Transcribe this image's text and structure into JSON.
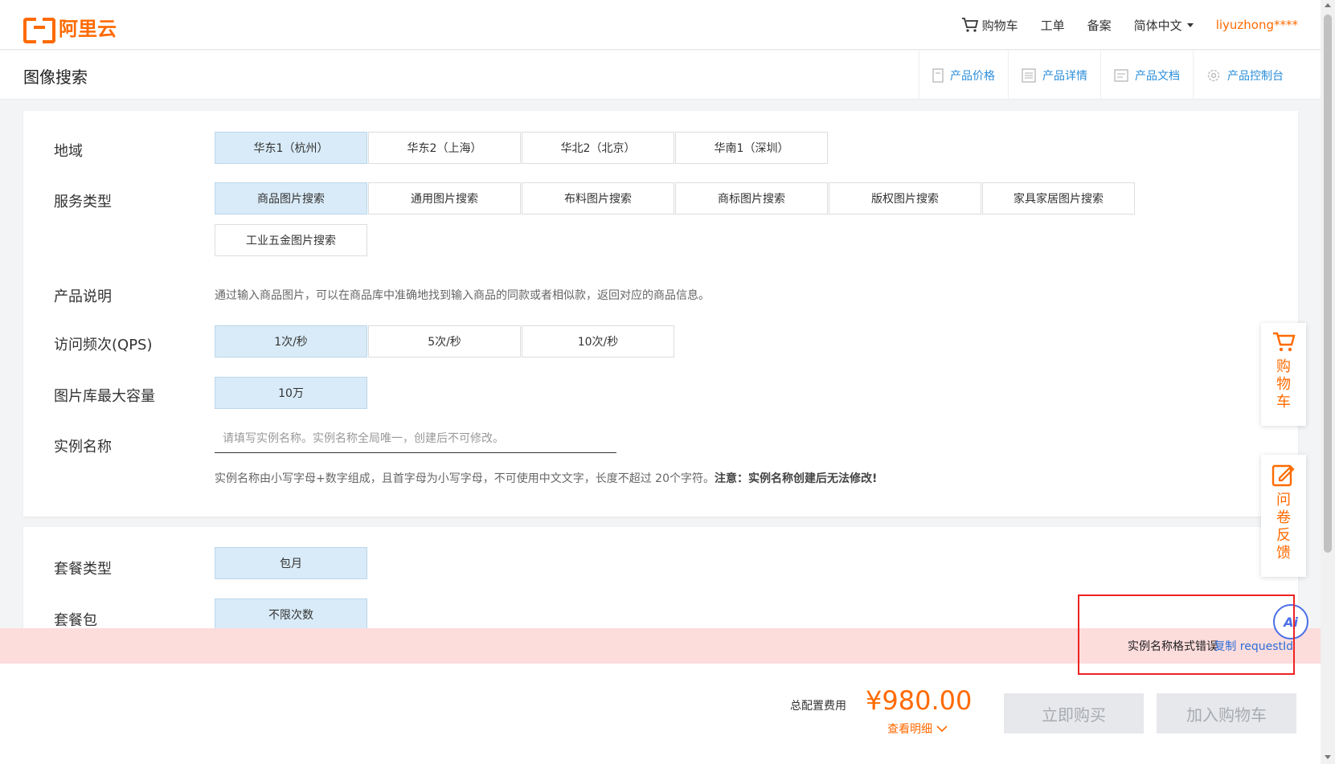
{
  "header": {
    "logo_text": "阿里云",
    "nav": {
      "cart": "购物车",
      "ticket": "工单",
      "filing": "备案",
      "language": "简体中文",
      "user": "liyuzhong****"
    }
  },
  "product_bar": {
    "title": "图像搜索",
    "links": [
      "产品价格",
      "产品详情",
      "产品文档",
      "产品控制台"
    ]
  },
  "config": {
    "region": {
      "label": "地域",
      "options": [
        "华东1（杭州）",
        "华东2（上海）",
        "华北2（北京）",
        "华南1（深圳）"
      ],
      "selected": "华东1（杭州）"
    },
    "service_type": {
      "label": "服务类型",
      "options": [
        "商品图片搜索",
        "通用图片搜索",
        "布料图片搜索",
        "商标图片搜索",
        "版权图片搜索",
        "家具家居图片搜索",
        "工业五金图片搜索"
      ],
      "selected": "商品图片搜索"
    },
    "product_desc": {
      "label": "产品说明",
      "text": "通过输入商品图片，可以在商品库中准确地找到输入商品的同款或者相似款，返回对应的商品信息。"
    },
    "qps": {
      "label": "访问频次(QPS)",
      "options": [
        "1次/秒",
        "5次/秒",
        "10次/秒"
      ],
      "selected": "1次/秒"
    },
    "capacity": {
      "label": "图片库最大容量",
      "options": [
        "10万"
      ],
      "selected": "10万"
    },
    "instance_name": {
      "label": "实例名称",
      "value": "",
      "placeholder": "请填写实例名称。实例名称全局唯一，创建后不可修改。",
      "hint": "实例名称由小写字母+数字组成，且首字母为小写字母，不可使用中文文字，长度不超过 20个字符。",
      "hint_bold": "注意：实例名称创建后无法修改!"
    }
  },
  "package": {
    "type": {
      "label": "套餐类型",
      "options": [
        "包月"
      ],
      "selected": "包月"
    },
    "pack": {
      "label": "套餐包",
      "options": [
        "不限次数"
      ],
      "selected": "不限次数"
    }
  },
  "error_bar": {
    "message": "实例名称格式错误",
    "copy_link": "复制 requestId"
  },
  "footer": {
    "total_label": "总配置费用",
    "price": "¥980.00",
    "detail_link": "查看明细",
    "buy_button": "立即购买",
    "add_cart_button": "加入购物车"
  },
  "floating": {
    "cart_label": "购物车",
    "feedback_label": "问卷反馈",
    "ai_label": "Ai"
  },
  "colors": {
    "brand": "#ff6a00",
    "link": "#2b8ed8",
    "selected_bg": "#d9ebf8",
    "error_bg": "#fddcdc",
    "highlight_box": "#e22222"
  }
}
